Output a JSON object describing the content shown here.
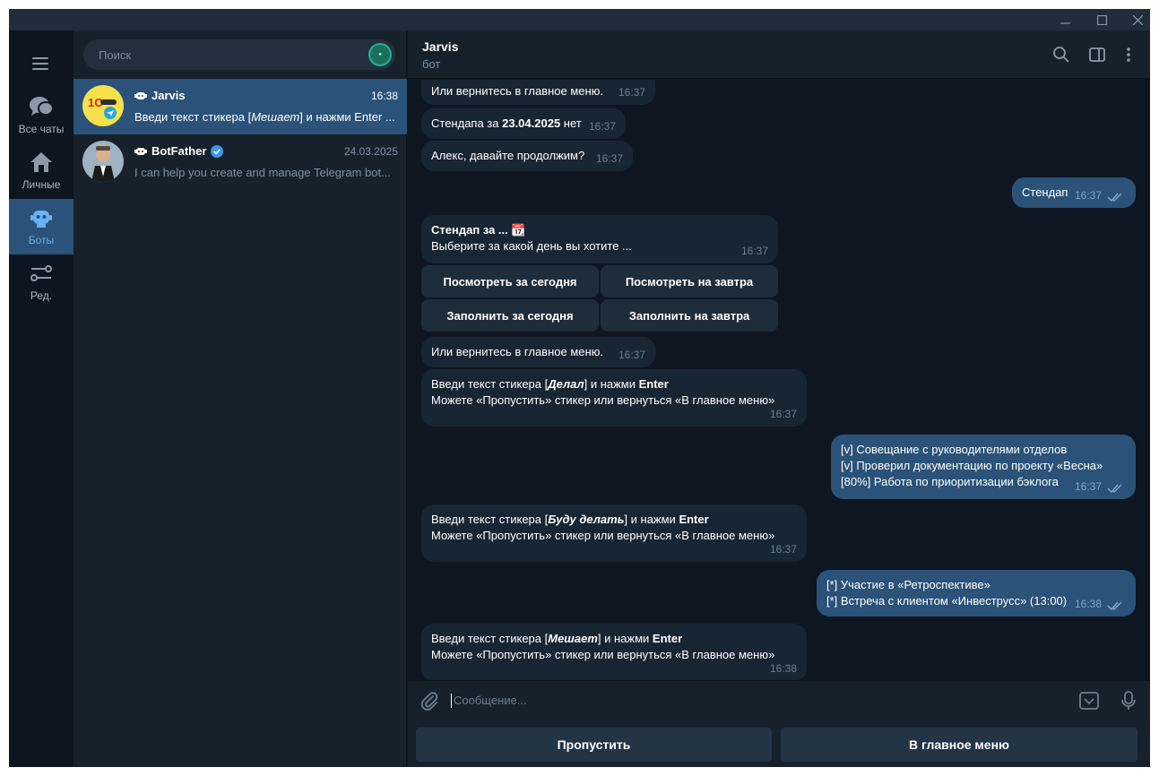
{
  "window": {
    "minimize_icon": "minimize-icon",
    "maximize_icon": "maximize-icon",
    "close_icon": "close-icon"
  },
  "nav": {
    "items": [
      {
        "label": "Все чаты",
        "icon": "chats-icon"
      },
      {
        "label": "Личные",
        "icon": "home-icon"
      },
      {
        "label": "Боты",
        "icon": "bot-icon",
        "active": true
      },
      {
        "label": "Ред.",
        "icon": "edit-filters-icon"
      }
    ]
  },
  "search": {
    "placeholder": "Поиск"
  },
  "chats": [
    {
      "name": "Jarvis",
      "time": "16:38",
      "preview": "Введи текст стикера [Мешает] и нажми Enter ...",
      "active": true
    },
    {
      "name": "BotFather",
      "time": "24.03.2025",
      "preview": "I can help you create and manage Telegram bot...",
      "verified": true
    }
  ],
  "header": {
    "title": "Jarvis",
    "subtitle": "бот"
  },
  "messages": {
    "m0": {
      "text": "Или вернитесь в главное меню.",
      "time": "16:37"
    },
    "m1": {
      "pre": "Стендапа за ",
      "bold": "23.04.2025",
      "post": " нет",
      "time": "16:37"
    },
    "m2": {
      "text": "Алекс, давайте продолжим?",
      "time": "16:37"
    },
    "m3": {
      "text": "Стендап",
      "time": "16:37"
    },
    "m4": {
      "line1": "Стендап за ... 📆",
      "line2": "Выберите за какой день вы хотите ...",
      "time": "16:37"
    },
    "kb": [
      "Посмотреть за сегодня",
      "Посмотреть на завтра",
      "Заполнить за сегодня",
      "Заполнить на завтра"
    ],
    "m5": {
      "text": "Или вернитесь в главное меню.",
      "time": "16:37"
    },
    "m6": {
      "pre": "Введи текст стикера [",
      "italic": "Делал",
      "mid": "] и нажми ",
      "enter": "Enter",
      "line2": "Можете «Пропустить» стикер или вернуться «В главное меню»",
      "time": "16:37"
    },
    "m7": {
      "lines": [
        "[v] Совещание с руководителями отделов",
        "[v] Проверил документацию по проекту «Весна»",
        "[80%] Работа по приоритизации бэклога"
      ],
      "time": "16:37"
    },
    "m8": {
      "pre": "Введи текст стикера [",
      "italic": "Буду делать",
      "mid": "] и нажми ",
      "enter": "Enter",
      "line2": "Можете «Пропустить» стикер или вернуться «В главное меню»",
      "time": "16:37"
    },
    "m9": {
      "lines": [
        "[*] Участие в «Ретроспективе»",
        "[*] Встреча с клиентом «Инвеструсс» (13:00)"
      ],
      "time": "16:38"
    },
    "m10": {
      "pre": "Введи текст стикера [",
      "italic": "Мешает",
      "mid": "] и нажми ",
      "enter": "Enter",
      "line2": "Можете «Пропустить» стикер или вернуться «В главное меню»",
      "time": "16:38"
    }
  },
  "composer": {
    "placeholder": "Сообщение...",
    "reply_buttons": [
      "Пропустить",
      "В главное меню"
    ]
  },
  "colors": {
    "bg": "#0e1621",
    "panel": "#17212b",
    "accent": "#2b5278",
    "link": "#6ab3f3"
  }
}
